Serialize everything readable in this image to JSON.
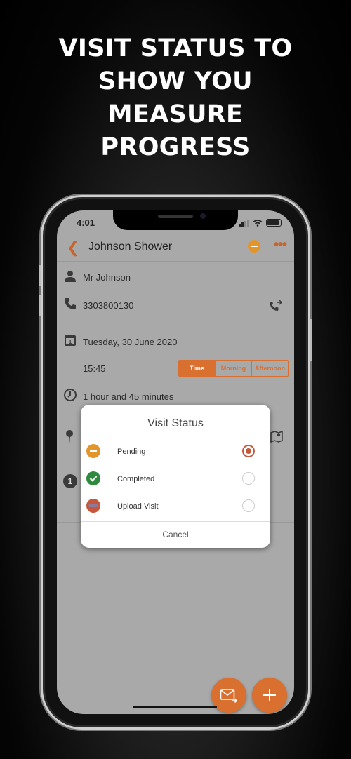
{
  "headline": {
    "lines": [
      "VISIT STATUS TO",
      "SHOW YOU",
      "MEASURE",
      "PROGRESS"
    ]
  },
  "statusbar": {
    "time": "4:01"
  },
  "nav": {
    "back_icon": "chevron-left-icon",
    "title": "Johnson Shower",
    "more_icon": "more-dots-icon"
  },
  "details": {
    "contact_name": "Mr Johnson",
    "phone": "3303800130",
    "date": "Tuesday, 30 June 2020",
    "calendar_day": "1",
    "time": "15:45",
    "time_segments": [
      "Time",
      "Morning",
      "Afternoon"
    ],
    "selected_segment": "Time",
    "duration": "1 hour and 45 minutes",
    "task_number": "1"
  },
  "dialog": {
    "title": "Visit Status",
    "options": [
      {
        "label": "Pending",
        "icon": "pending-icon",
        "color": "#e4952a",
        "selected": true
      },
      {
        "label": "Completed",
        "icon": "check-icon",
        "color": "#2f8a3e",
        "selected": false
      },
      {
        "label": "Upload Visit",
        "icon": "upload-icon",
        "color": "#c6573a",
        "selected": false
      }
    ],
    "cancel_label": "Cancel"
  },
  "colors": {
    "accent": "#d9702f",
    "overlay": "#a9a9a9",
    "pending": "#e4952a",
    "completed": "#2f8a3e"
  },
  "fabs": {
    "message_icon": "send-message-icon",
    "add_icon": "plus-icon"
  }
}
